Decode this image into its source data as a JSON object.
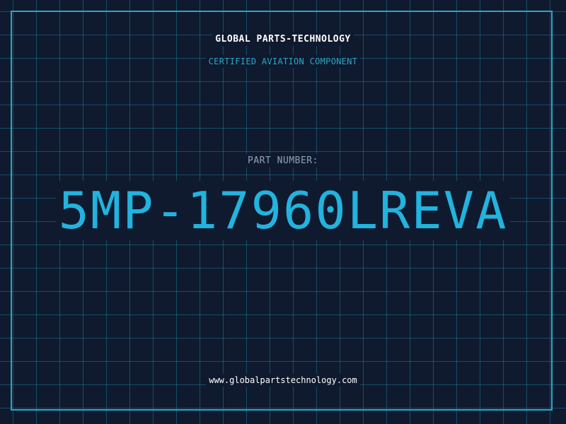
{
  "header": {
    "brand": "GLOBAL PARTS-TECHNOLOGY",
    "subtitle": "CERTIFIED AVIATION COMPONENT"
  },
  "part": {
    "label": "PART NUMBER:",
    "number": "5MP-17960LREVA"
  },
  "footer": {
    "url": "www.globalpartstechnology.com"
  },
  "colors": {
    "background": "#0f1a2e",
    "accent": "#22b3de",
    "grid": "#1e8caa",
    "label": "#8fa2b8",
    "text": "#ffffff"
  }
}
